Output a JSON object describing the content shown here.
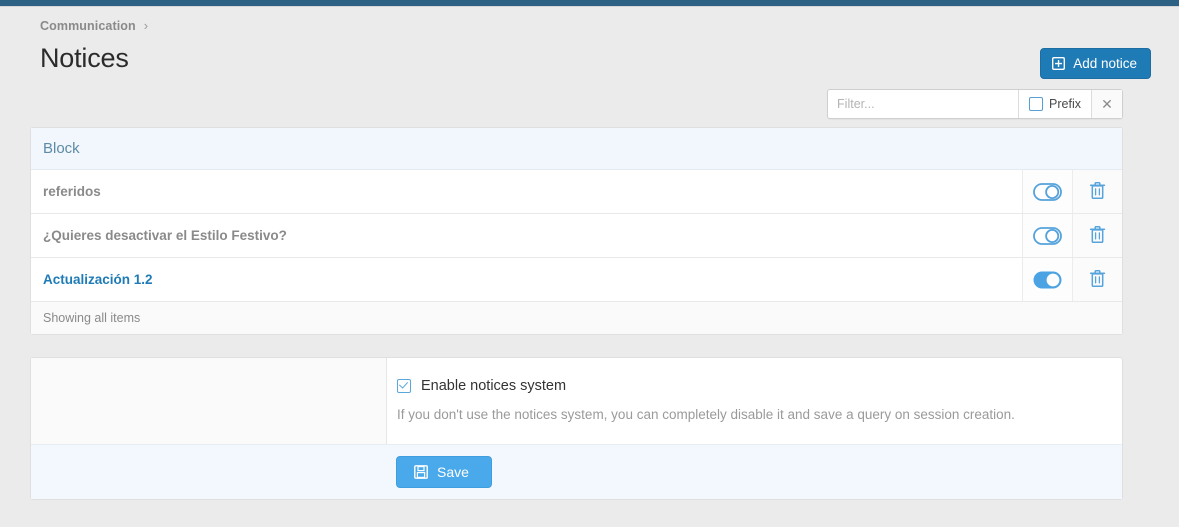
{
  "breadcrumb": {
    "items": [
      "Communication"
    ],
    "separator": "›"
  },
  "header": {
    "title": "Notices",
    "add_button": {
      "label": "Add notice",
      "icon": "plus-square-icon"
    }
  },
  "filter_bar": {
    "input_value": "",
    "placeholder": "Filter...",
    "prefix_label": "Prefix",
    "prefix_checked": false,
    "clear_icon": "close-icon",
    "clear_glyph": "✕"
  },
  "notices_table": {
    "columns": [
      "Block"
    ],
    "rows": [
      {
        "block": "referidos",
        "enabled": false,
        "active": false,
        "toggle_icon": "toggle-off-icon",
        "delete_icon": "trash-icon"
      },
      {
        "block": "¿Quieres desactivar el Estilo Festivo?",
        "enabled": false,
        "active": false,
        "toggle_icon": "toggle-off-icon",
        "delete_icon": "trash-icon"
      },
      {
        "block": "Actualización 1.2",
        "enabled": true,
        "active": true,
        "toggle_icon": "toggle-on-icon",
        "delete_icon": "trash-icon"
      }
    ],
    "footer_text": "Showing all items"
  },
  "settings": {
    "enable_checkbox": {
      "label": "Enable notices system",
      "checked": true
    },
    "help_text": "If you don't use the notices system, you can completely disable it and save a query on session creation.",
    "save_button": {
      "label": "Save",
      "icon": "floppy-save-icon"
    }
  },
  "colors": {
    "topbar": "#2d6285",
    "primary_button": "#1f7bb6",
    "save_button": "#49a9ea",
    "accent_link": "#1f7bb6",
    "table_header_bg": "#f1f7fc",
    "table_header_text": "#5d8ba6",
    "page_bg": "#ebebeb"
  }
}
